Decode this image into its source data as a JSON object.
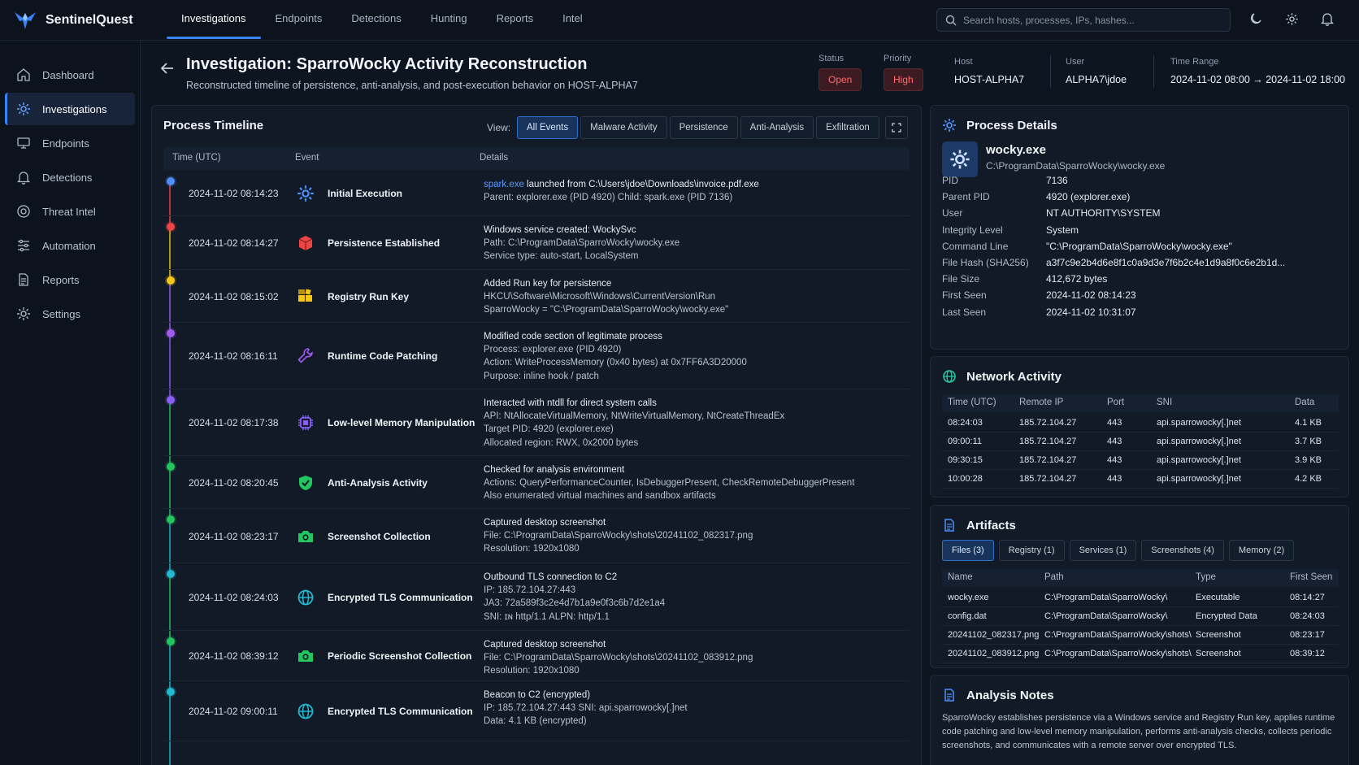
{
  "app": {
    "name": "SentinelQuest"
  },
  "topnav": [
    {
      "label": "Investigations",
      "active": true
    },
    {
      "label": "Endpoints"
    },
    {
      "label": "Detections"
    },
    {
      "label": "Hunting"
    },
    {
      "label": "Reports"
    },
    {
      "label": "Intel"
    }
  ],
  "search": {
    "placeholder": "Search hosts, processes, IPs, hashes..."
  },
  "sidebar": [
    {
      "label": "Dashboard",
      "icon": "home-icon"
    },
    {
      "label": "Investigations",
      "icon": "gear-icon",
      "active": true
    },
    {
      "label": "Endpoints",
      "icon": "monitor-icon"
    },
    {
      "label": "Detections",
      "icon": "bell-icon"
    },
    {
      "label": "Threat Intel",
      "icon": "globe-icon"
    },
    {
      "label": "Automation",
      "icon": "sliders-icon"
    },
    {
      "label": "Reports",
      "icon": "document-icon"
    },
    {
      "label": "Settings",
      "icon": "gear-icon"
    }
  ],
  "header": {
    "title": "Investigation: SparroWocky Activity Reconstruction",
    "subtitle": "Reconstructed timeline of persistence, anti-analysis, and post-execution behavior on HOST-ALPHA7",
    "status_label": "Status",
    "status": "Open",
    "priority_label": "Priority",
    "priority": "High",
    "host_label": "Host",
    "host": "HOST-ALPHA7",
    "user_label": "User",
    "user": "ALPHA7\\jdoe",
    "range_label": "Time Range",
    "range": "2024-11-02 08:00 → 2024-11-02 18:00"
  },
  "timeline": {
    "title": "Process Timeline",
    "view_label": "View:",
    "view_tabs": [
      "All Events",
      "Malware Activity",
      "Persistence",
      "Anti-Analysis",
      "Exfiltration"
    ],
    "columns": [
      "Time (UTC)",
      "Event",
      "Details"
    ],
    "events": [
      {
        "time": "2024-11-02 08:14:23",
        "event": "Initial Execution",
        "icon": "gear-icon",
        "color": "#4f8ff7",
        "details": [
          "spark.exe launched from C:\\Users\\jdoe\\Downloads\\invoice.pdf.exe",
          "Parent: explorer.exe (PID 4920)     Child: spark.exe (PID 7136)"
        ]
      },
      {
        "time": "2024-11-02 08:14:27",
        "event": "Persistence Established",
        "icon": "package-icon",
        "color": "#ef4444",
        "details": [
          "Windows service created: WockySvc",
          "Path: C:\\ProgramData\\SparroWocky\\wocky.exe",
          "Service type: auto-start, LocalSystem"
        ]
      },
      {
        "time": "2024-11-02 08:15:02",
        "event": "Registry Run Key",
        "icon": "registry-icon",
        "color": "#f5c518",
        "details": [
          "Added Run key for persistence",
          "HKCU\\Software\\Microsoft\\Windows\\CurrentVersion\\Run",
          "SparroWocky = \"C:\\ProgramData\\SparroWocky\\wocky.exe\""
        ]
      },
      {
        "time": "2024-11-02 08:16:11",
        "event": "Runtime Code Patching",
        "icon": "wrench-icon",
        "color": "#a05cf0",
        "details": [
          "Modified code section of legitimate process",
          "Process: explorer.exe (PID 4920)",
          "Action: WriteProcessMemory (0x40 bytes) at 0x7FF6A3D20000",
          "Purpose: inline hook / patch"
        ]
      },
      {
        "time": "2024-11-02 08:17:38",
        "event": "Low-level Memory Manipulation",
        "icon": "chip-icon",
        "color": "#8b5cf6",
        "details": [
          "Interacted with ntdll for direct system calls",
          "API: NtAllocateVirtualMemory, NtWriteVirtualMemory, NtCreateThreadEx",
          "Target PID: 4920 (explorer.exe)",
          "Allocated region: RWX, 0x2000 bytes"
        ]
      },
      {
        "time": "2024-11-02 08:20:45",
        "event": "Anti-Analysis Activity",
        "icon": "shield-check-icon",
        "color": "#22c55e",
        "details": [
          "Checked for analysis environment",
          "Actions: QueryPerformanceCounter, IsDebuggerPresent, CheckRemoteDebuggerPresent",
          "Also enumerated virtual machines and sandbox artifacts"
        ]
      },
      {
        "time": "2024-11-02 08:23:17",
        "event": "Screenshot Collection",
        "icon": "camera-icon",
        "color": "#22c55e",
        "details": [
          "Captured desktop screenshot",
          "File: C:\\ProgramData\\SparroWocky\\shots\\20241102_082317.png",
          "Resolution: 1920x1080"
        ]
      },
      {
        "time": "2024-11-02 08:24:03",
        "event": "Encrypted TLS Communication",
        "icon": "globe-icon",
        "color": "#22b8cf",
        "details": [
          "Outbound TLS connection to C2",
          "IP: 185.72.104.27:443",
          "JA3: 72a589f3c2e4d7b1a9e0f3c6b7d2e1a4",
          "SNI: ɪɴ http/1.1     ALPN: http/1.1"
        ]
      },
      {
        "time": "2024-11-02 08:39:12",
        "event": "Periodic Screenshot Collection",
        "icon": "camera-icon",
        "color": "#22c55e",
        "details": [
          "Captured desktop screenshot",
          "File: C:\\ProgramData\\SparroWocky\\shots\\20241102_083912.png",
          "Resolution: 1920x1080"
        ]
      },
      {
        "time": "2024-11-02 09:00:11",
        "event": "Encrypted TLS Communication",
        "icon": "globe-icon",
        "color": "#22b8cf",
        "details": [
          "Beacon to C2 (encrypted)",
          "IP: 185.72.104.27:443                    SNI: api.sparrowocky[.]net",
          "Data: 4.1 KB (encrypted)"
        ]
      }
    ]
  },
  "process": {
    "title": "Process Details",
    "name": "wocky.exe",
    "path": "C:\\ProgramData\\SparroWocky\\wocky.exe",
    "fields": [
      {
        "k": "PID",
        "v": "7136"
      },
      {
        "k": "Parent PID",
        "v": "4920 (explorer.exe)"
      },
      {
        "k": "User",
        "v": "NT AUTHORITY\\SYSTEM"
      },
      {
        "k": "Integrity Level",
        "v": "System"
      },
      {
        "k": "Command Line",
        "v": "\"C:\\ProgramData\\SparroWocky\\wocky.exe\""
      },
      {
        "k": "File Hash (SHA256)",
        "v": "a3f7c9e2b4d6e8f1c0a9d3e7f6b2c4e1d9a8f0c6e2b1d..."
      },
      {
        "k": "File Size",
        "v": "412,672 bytes"
      },
      {
        "k": "First Seen",
        "v": "2024-11-02 08:14:23"
      },
      {
        "k": "Last Seen",
        "v": "2024-11-02 10:31:07"
      }
    ]
  },
  "network": {
    "title": "Network Activity",
    "columns": [
      "Time (UTC)",
      "Remote IP",
      "Port",
      "SNI",
      "Data"
    ],
    "rows": [
      [
        "08:24:03",
        "185.72.104.27",
        "443",
        "api.sparrowocky[.]net",
        "4.1 KB"
      ],
      [
        "09:00:11",
        "185.72.104.27",
        "443",
        "api.sparrowocky[.]net",
        "3.7 KB"
      ],
      [
        "09:30:15",
        "185.72.104.27",
        "443",
        "api.sparrowocky[.]net",
        "3.9 KB"
      ],
      [
        "10:00:28",
        "185.72.104.27",
        "443",
        "api.sparrowocky[.]net",
        "4.2 KB"
      ]
    ]
  },
  "artifacts": {
    "title": "Artifacts",
    "tabs": [
      "Files (3)",
      "Registry (1)",
      "Services (1)",
      "Screenshots (4)",
      "Memory (2)"
    ],
    "columns": [
      "Name",
      "Path",
      "Type",
      "First Seen"
    ],
    "rows": [
      [
        "wocky.exe",
        "C:\\ProgramData\\SparroWocky\\",
        "Executable",
        "08:14:27"
      ],
      [
        "config.dat",
        "C:\\ProgramData\\SparroWocky\\",
        "Encrypted Data",
        "08:24:03"
      ],
      [
        "20241102_082317.png",
        "C:\\ProgramData\\SparroWocky\\shots\\",
        "Screenshot",
        "08:23:17"
      ],
      [
        "20241102_083912.png",
        "C:\\ProgramData\\SparroWocky\\shots\\",
        "Screenshot",
        "08:39:12"
      ]
    ]
  },
  "notes": {
    "title": "Analysis Notes",
    "text": "SparroWocky establishes persistence via a Windows service and Registry Run key, applies runtime code patching and low-level memory manipulation, performs anti-analysis checks, collects periodic screenshots, and communicates with a remote server over encrypted TLS."
  }
}
